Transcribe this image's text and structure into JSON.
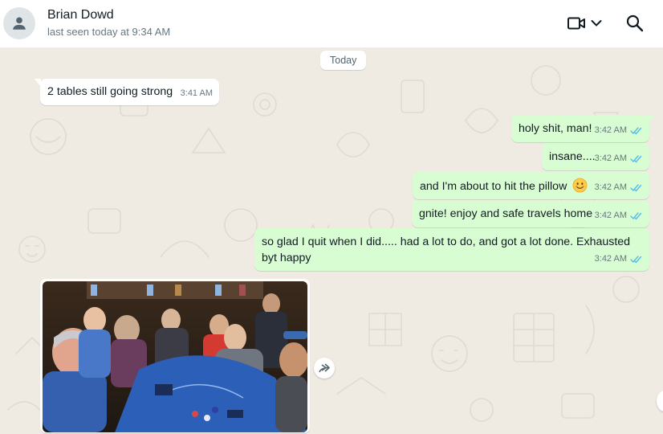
{
  "header": {
    "contact_name": "Brian Dowd",
    "last_seen": "last seen today at 9:34 AM",
    "icons": {
      "avatar": "person-icon",
      "video": "video-call-icon",
      "dropdown": "chevron-down-icon",
      "search": "search-icon"
    }
  },
  "chat": {
    "date_chip": "Today",
    "messages": [
      {
        "direction": "in",
        "text": "2 tables still going strong",
        "time": "3:41 AM"
      },
      {
        "direction": "out",
        "text": "holy shit, man!",
        "time": "3:42 AM",
        "status": "read"
      },
      {
        "direction": "out",
        "text": "insane....",
        "time": "3:42 AM",
        "status": "read"
      },
      {
        "direction": "out",
        "text": "and I'm about to hit the pillow",
        "emoji": "smiling-face",
        "time": "3:42 AM",
        "status": "read"
      },
      {
        "direction": "out",
        "text": "gnite! enjoy and safe travels home",
        "time": "3:42 AM",
        "status": "read"
      },
      {
        "direction": "out",
        "text": "so glad I quit when I did..... had a lot to do, and got a lot done. Exhausted byt happy",
        "time": "3:42 AM",
        "status": "read"
      }
    ],
    "photo_message": {
      "direction": "in",
      "subject": "poker-table-photo",
      "forward_icon": "forward-icon"
    }
  },
  "colors": {
    "chat_background": "#efeae2",
    "incoming_bubble": "#ffffff",
    "outgoing_bubble": "#d9fdd3",
    "read_ticks": "#53bdeb",
    "poker_table": "#2c5fb8"
  }
}
